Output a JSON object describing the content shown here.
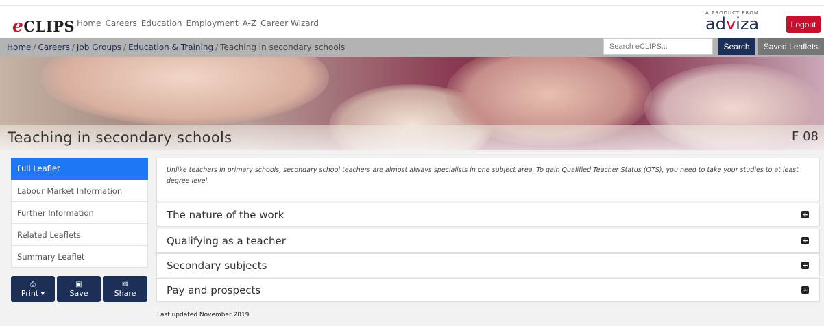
{
  "header": {
    "logo": "CLIPS",
    "logo_e": "e",
    "nav": [
      "Home",
      "Careers",
      "Education",
      "Employment",
      "A-Z",
      "Career Wizard"
    ],
    "brand_small": "A PRODUCT FROM",
    "brand_pre": "ad",
    "brand_v": "v",
    "brand_post": "iza",
    "logout": "Logout"
  },
  "breadcrumb": {
    "items": [
      "Home",
      "Careers",
      "Job Groups",
      "Education & Training"
    ],
    "current": "Teaching in secondary schools",
    "separator": "/"
  },
  "search": {
    "placeholder": "Search eCLIPS...",
    "button": "Search",
    "saved": "Saved Leaflets"
  },
  "page": {
    "title": "Teaching in secondary schools",
    "code": "F 08"
  },
  "sidebar": {
    "items": [
      {
        "label": "Full Leaflet",
        "active": true
      },
      {
        "label": "Labour Market Information"
      },
      {
        "label": "Further Information"
      },
      {
        "label": "Related Leaflets"
      },
      {
        "label": "Summary Leaflet"
      }
    ],
    "actions": [
      {
        "icon": "print-icon",
        "glyph": "⎙",
        "label": "Print ▾"
      },
      {
        "icon": "save-icon",
        "glyph": "▣",
        "label": "Save"
      },
      {
        "icon": "envelope-icon",
        "glyph": "✉",
        "label": "Share"
      }
    ]
  },
  "content": {
    "intro": "Unlike teachers in primary schools, secondary school teachers are almost always specialists in one subject area. To gain Qualified Teacher Status (QTS), you need to take your studies to at least degree level.",
    "sections": [
      "The nature of the work",
      "Qualifying as a teacher",
      "Secondary subjects",
      "Pay and prospects"
    ],
    "expand_symbol": "+",
    "updated": "Last updated November 2019"
  }
}
